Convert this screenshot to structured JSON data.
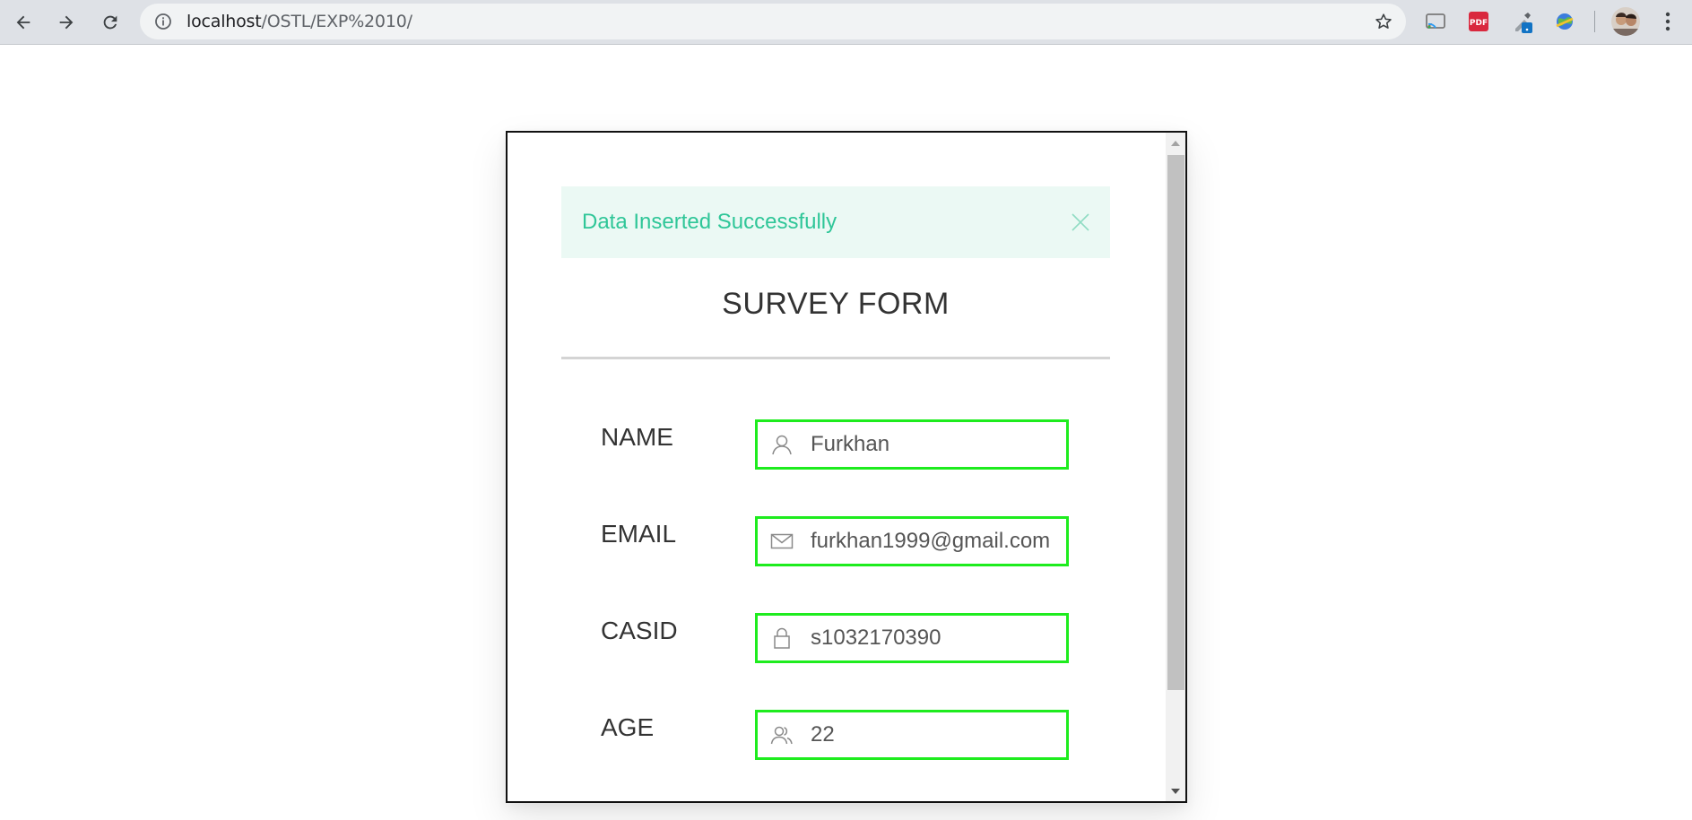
{
  "browser": {
    "url_host": "localhost",
    "url_path": "/OSTL/EXP%2010/",
    "back_label": "back",
    "forward_label": "forward",
    "reload_label": "reload"
  },
  "alert": {
    "message": "Data Inserted Successfully",
    "color": "#2fc698",
    "background": "#ebf9f4"
  },
  "form": {
    "title": "SURVEY FORM",
    "field_border_color": "#1eec1e",
    "fields": [
      {
        "label": "NAME",
        "value": "Furkhan",
        "icon": "user-icon"
      },
      {
        "label": "EMAIL",
        "value": "furkhan1999@gmail.com",
        "icon": "envelope-icon"
      },
      {
        "label": "CASID",
        "value": "s1032170390",
        "icon": "lock-icon"
      },
      {
        "label": "AGE",
        "value": "22",
        "icon": "users-icon"
      }
    ]
  }
}
